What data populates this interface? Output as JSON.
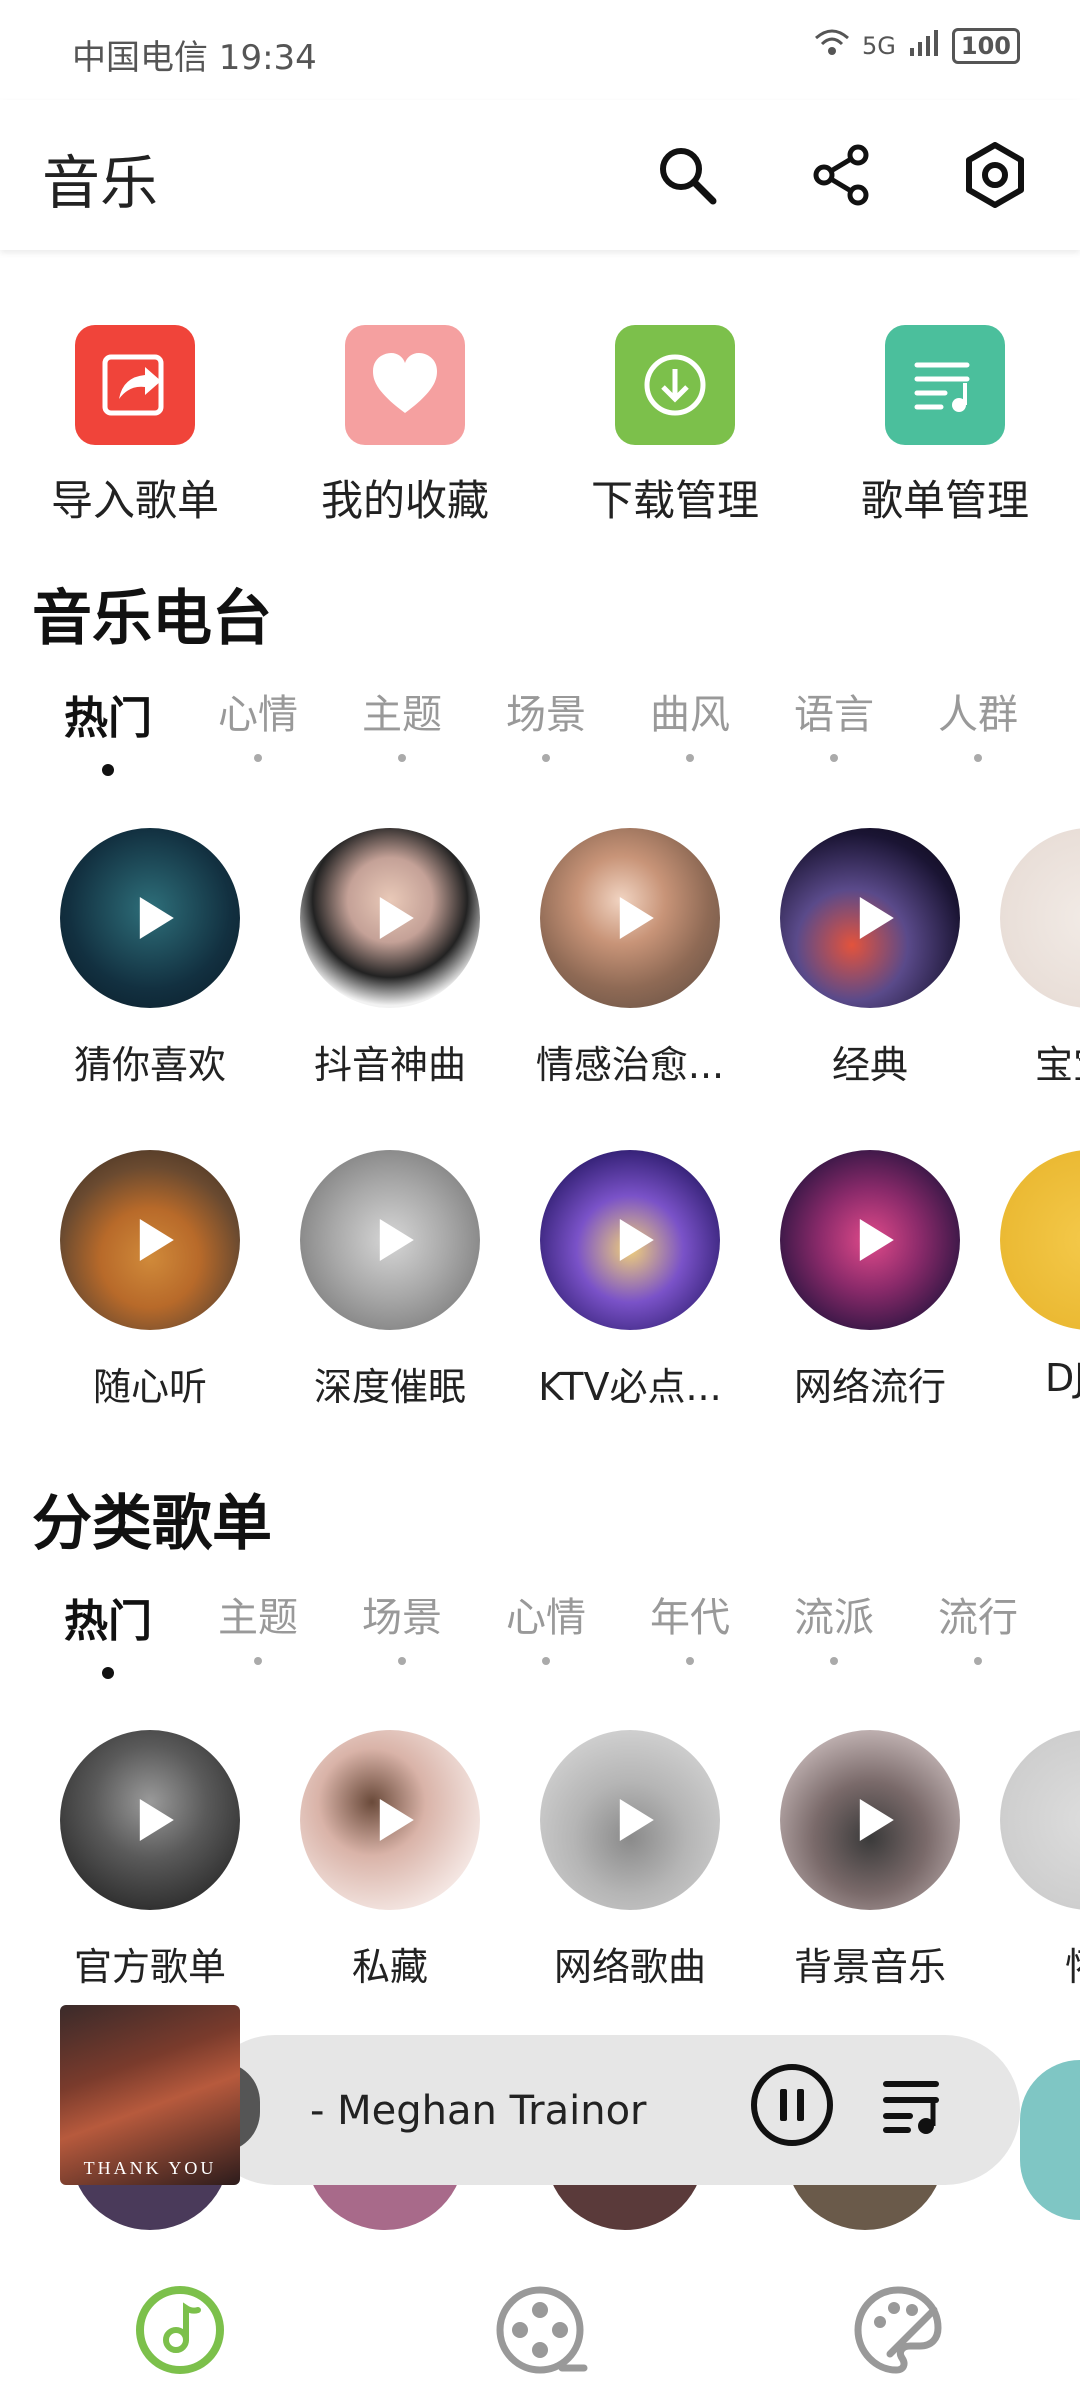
{
  "status_bar": {
    "carrier_time": "中国电信 19:34",
    "wifi_badge": "6",
    "net": "5G",
    "battery": "100"
  },
  "app_bar": {
    "title": "音乐",
    "icons": [
      "search-icon",
      "share-icon",
      "settings-icon"
    ]
  },
  "quick_entries": [
    {
      "label": "导入歌单",
      "icon": "import-icon",
      "color": "#f0443a"
    },
    {
      "label": "我的收藏",
      "icon": "heart-icon",
      "color": "#f5a0a0"
    },
    {
      "label": "下载管理",
      "icon": "download-icon",
      "color": "#7cc04b"
    },
    {
      "label": "歌单管理",
      "icon": "playlist-icon",
      "color": "#4bbf9c"
    }
  ],
  "radio": {
    "title": "音乐电台",
    "tabs": [
      "热门",
      "心情",
      "主题",
      "场景",
      "曲风",
      "语言",
      "人群"
    ],
    "active_tab": "热门",
    "row1": [
      "猜你喜欢",
      "抖音神曲",
      "情感治愈...",
      "经典",
      "宝宝"
    ],
    "row2": [
      "随心听",
      "深度催眠",
      "KTV必点...",
      "网络流行",
      "DJ"
    ]
  },
  "playlists": {
    "title": "分类歌单",
    "tabs": [
      "热门",
      "主题",
      "场景",
      "心情",
      "年代",
      "流派",
      "流行"
    ],
    "active_tab": "热门",
    "row1": [
      "官方歌单",
      "私藏",
      "网络歌曲",
      "背景音乐",
      "怀"
    ]
  },
  "mini_player": {
    "track": "- Meghan Trainor",
    "cover_text": "THANK YOU",
    "state": "playing"
  },
  "bottom_nav": [
    "music-icon",
    "video-icon",
    "theme-icon"
  ],
  "colors": {
    "accent": "#7cc04b"
  }
}
